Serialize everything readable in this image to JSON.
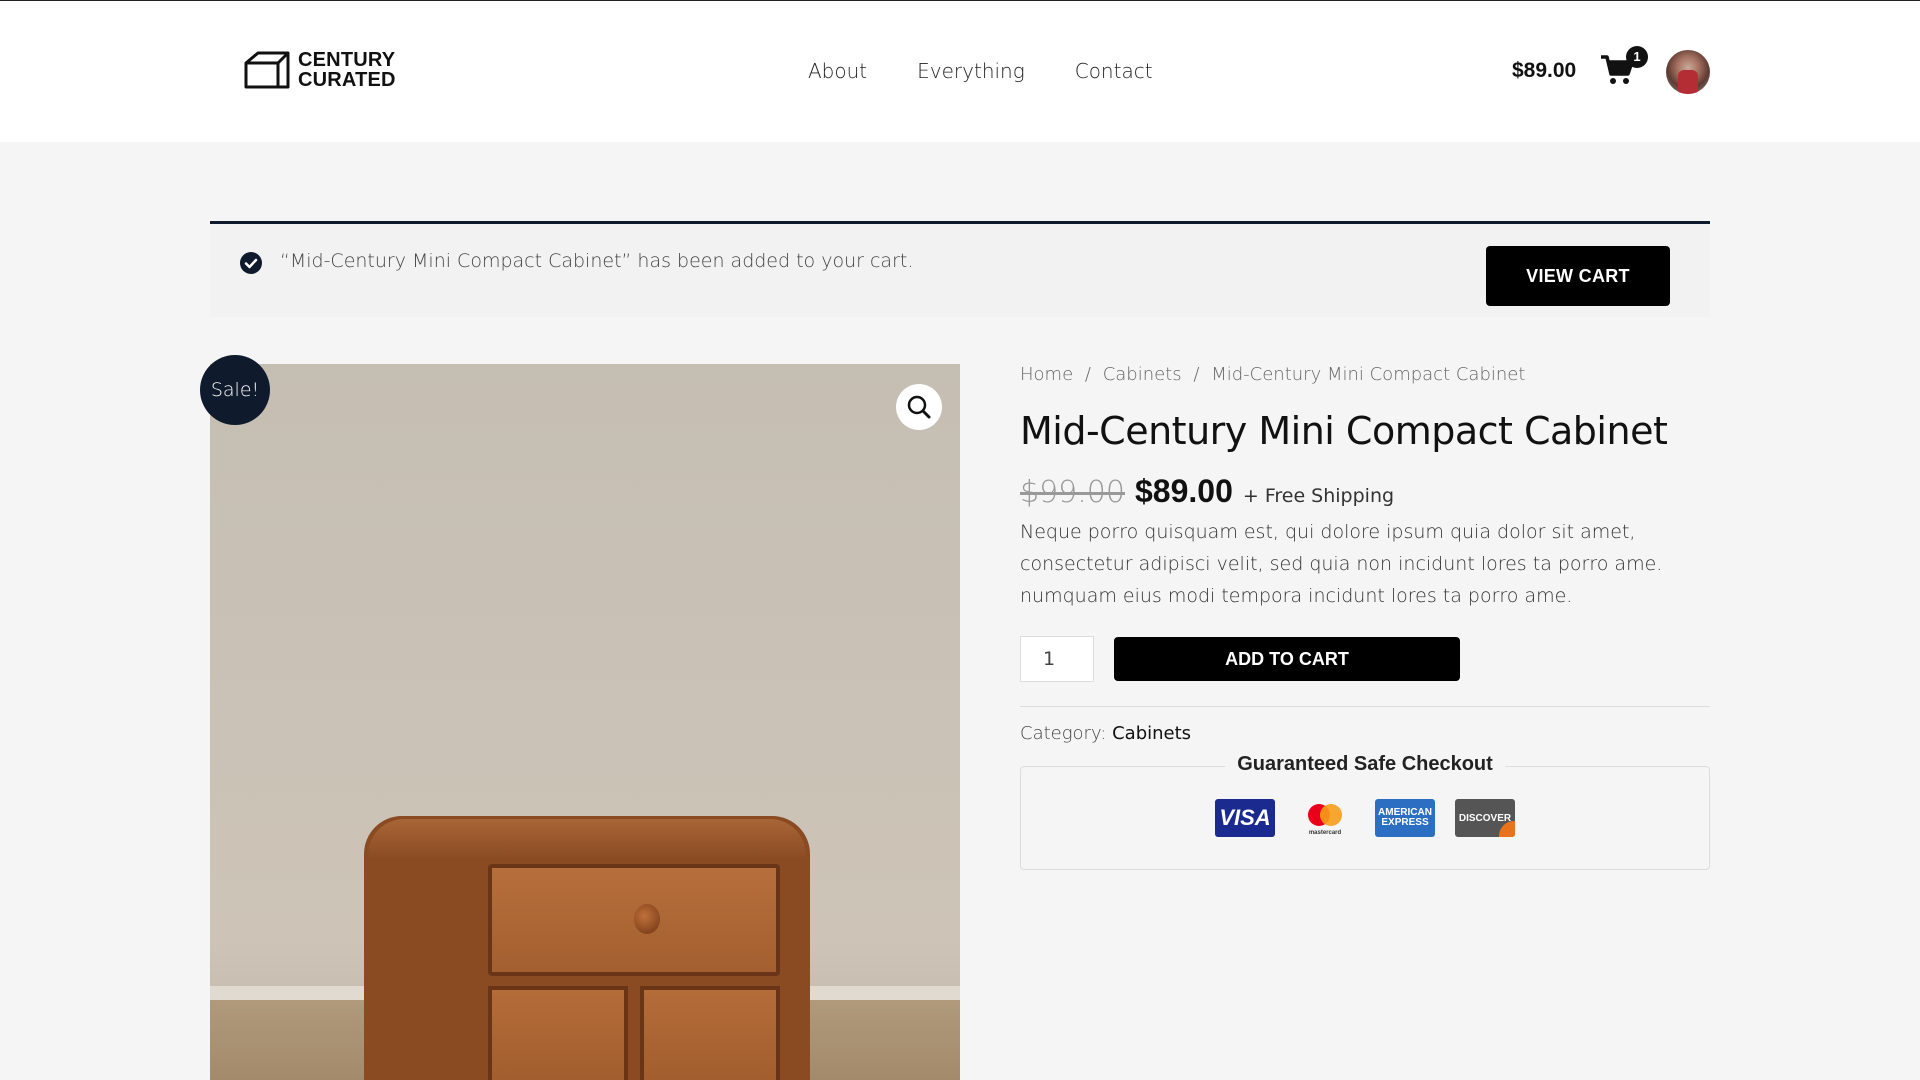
{
  "header": {
    "logo_line1": "CENTURY",
    "logo_line2": "CURATED",
    "nav": [
      "About",
      "Everything",
      "Contact"
    ],
    "cart_total": "$89.00",
    "cart_count": "1"
  },
  "notice": {
    "message": "“Mid-Century Mini Compact Cabinet” has been added to your cart.",
    "view_cart_label": "VIEW CART"
  },
  "product": {
    "sale_badge": "Sale!",
    "breadcrumb": [
      "Home",
      "Cabinets",
      "Mid-Century Mini Compact Cabinet"
    ],
    "breadcrumb_sep": "/",
    "title": "Mid-Century Mini Compact Cabinet",
    "old_price": "$99.00",
    "price": "$89.00",
    "shipping": "+ Free Shipping",
    "description": "Neque porro quisquam est, qui dolore ipsum quia dolor sit amet, consectetur adipisci velit, sed quia non incidunt lores ta porro ame. numquam eius modi tempora incidunt lores ta porro ame.",
    "quantity": "1",
    "add_to_cart_label": "ADD TO CART",
    "category_label": "Category:",
    "category": "Cabinets"
  },
  "checkout": {
    "title": "Guaranteed Safe Checkout",
    "cards": [
      "VISA",
      "mastercard",
      "AMERICAN EXPRESS",
      "DISCOVER"
    ]
  },
  "colors": {
    "accent": "#0f1b2c",
    "button": "#000000",
    "page_bg": "#f5f5f5"
  }
}
